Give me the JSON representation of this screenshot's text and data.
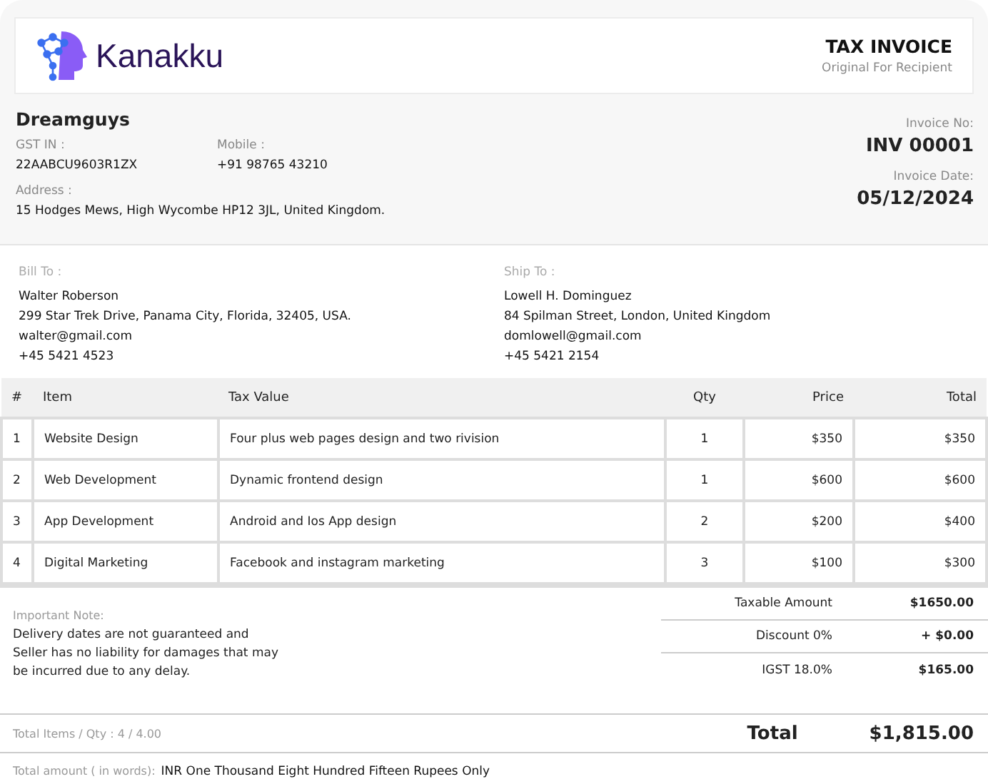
{
  "brand": {
    "name": "Kanakku"
  },
  "document": {
    "title": "TAX INVOICE",
    "subtitle": "Original For Recipient"
  },
  "seller": {
    "name": "Dreamguys",
    "gst_label": "GST IN :",
    "gst": "22AABCU9603R1ZX",
    "mobile_label": "Mobile :",
    "mobile": "+91 98765 43210",
    "address_label": "Address :",
    "address": "15 Hodges Mews, High Wycombe HP12 3JL, United Kingdom."
  },
  "invoice": {
    "number_label": "Invoice No:",
    "number": "INV 00001",
    "date_label": "Invoice Date:",
    "date": "05/12/2024"
  },
  "parties": [
    {
      "label": "Bill To :",
      "lines": [
        "Walter Roberson",
        "299 Star Trek Drive, Panama City, Florida, 32405, USA.",
        "walter@gmail.com",
        "+45 5421 4523"
      ]
    },
    {
      "label": "Ship To :",
      "lines": [
        "Lowell H. Dominguez",
        "84 Spilman Street, London, United Kingdom",
        "domlowell@gmail.com",
        "+45 5421 2154"
      ]
    }
  ],
  "table": {
    "columns": [
      "#",
      "Item",
      "Tax Value",
      "Qty",
      "Price",
      "Total"
    ],
    "rows": [
      [
        "1",
        "Website Design",
        "Four plus web pages design and two rivision",
        "1",
        "$350",
        "$350"
      ],
      [
        "2",
        "Web Development",
        "Dynamic frontend design",
        "1",
        "$600",
        "$600"
      ],
      [
        "3",
        "App Development",
        "Android and Ios App design",
        "2",
        "$200",
        "$400"
      ],
      [
        "4",
        "Digital Marketing",
        "Facebook and instagram marketing",
        "3",
        "$100",
        "$300"
      ]
    ]
  },
  "note": {
    "label": "Important Note:",
    "text": "Delivery dates are not guaranteed and Seller has no liability for damages that may be incurred due to any delay."
  },
  "summary": [
    {
      "label": "Taxable Amount",
      "value": "$1650.00"
    },
    {
      "label": "Discount 0%",
      "value": "+ $0.00"
    },
    {
      "label": "IGST 18.0%",
      "value": "$165.00"
    }
  ],
  "totals": {
    "items_label": "Total Items / Qty : 4 / 4.00",
    "label": "Total",
    "value": "$1,815.00"
  },
  "words": {
    "label": "Total amount ( in words):",
    "value": "INR One Thousand Eight Hundred Fifteen Rupees Only"
  }
}
